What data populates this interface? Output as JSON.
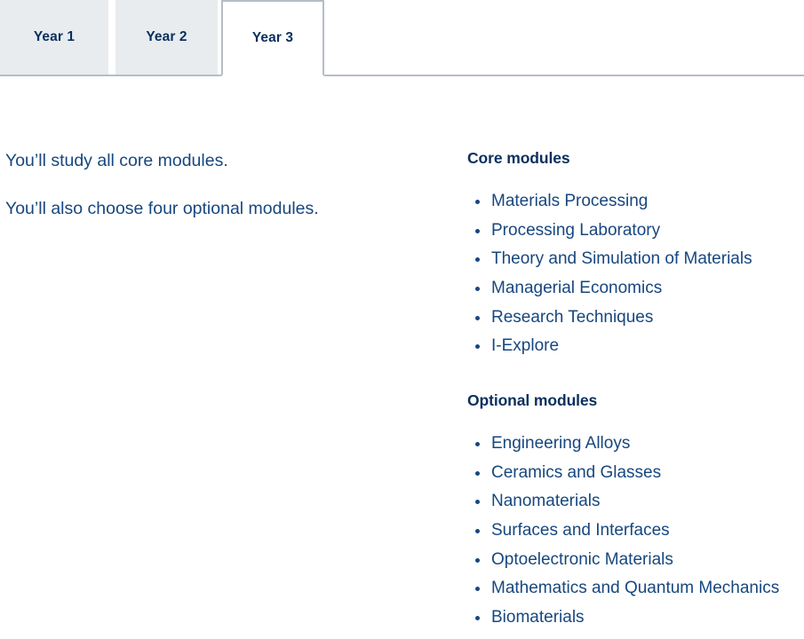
{
  "tabs": [
    {
      "label": "Year 1",
      "active": false
    },
    {
      "label": "Year 2",
      "active": false
    },
    {
      "label": "Year 3",
      "active": true
    }
  ],
  "left_column": {
    "paragraphs": [
      "You’ll study all core modules.",
      "You’ll also choose four optional modules."
    ]
  },
  "right_column": {
    "sections": [
      {
        "heading": "Core modules",
        "items": [
          "Materials Processing",
          "Processing Laboratory",
          "Theory and Simulation of Materials",
          "Managerial Economics",
          "Research Techniques",
          "I-Explore"
        ]
      },
      {
        "heading": "Optional modules",
        "items": [
          "Engineering Alloys",
          "Ceramics and Glasses",
          "Nanomaterials",
          "Surfaces and Interfaces",
          "Optoelectronic Materials",
          "Mathematics and Quantum Mechanics",
          "Biomaterials"
        ]
      }
    ]
  },
  "colors": {
    "heading_navy": "#0b2f5e",
    "body_blue": "#17477f",
    "tab_inactive_bg": "#e8ecee",
    "rule_gray": "#b6bcc8",
    "page_bg": "#ffffff"
  }
}
